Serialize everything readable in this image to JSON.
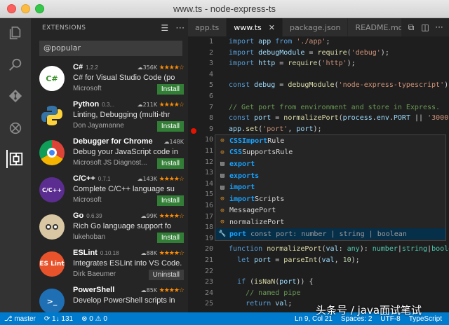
{
  "window": {
    "title": "www.ts - node-express-ts"
  },
  "sidebar": {
    "header": "EXTENSIONS",
    "search_value": "@popular",
    "extensions": [
      {
        "name": "C#",
        "version": "1.2.2",
        "downloads": "356K",
        "description": "C# for Visual Studio Code (po",
        "publisher": "Microsoft",
        "action": "Install",
        "logo_text": "C#",
        "logo_color": "#3a8f29"
      },
      {
        "name": "Python",
        "version": "0.3...",
        "downloads": "211K",
        "description": "Linting, Debugging (multi-thr",
        "publisher": "Don Jayamanne",
        "action": "Install",
        "logo_text": "Py",
        "logo_color": "#3572a5"
      },
      {
        "name": "Debugger for Chrome",
        "version": "",
        "downloads": "148K",
        "description": "Debug your JavaScript code in",
        "publisher": "Microsoft JS Diagnost...",
        "action": "Install",
        "logo_text": "",
        "logo_color": "#db4437"
      },
      {
        "name": "C/C++",
        "version": "0.7.1",
        "downloads": "143K",
        "description": "Complete C/C++ language su",
        "publisher": "Microsoft",
        "action": "Install",
        "logo_text": "C/C++",
        "logo_color": "#5c2d91"
      },
      {
        "name": "Go",
        "version": "0.6.39",
        "downloads": "99K",
        "description": "Rich Go language support fo",
        "publisher": "lukehoban",
        "action": "Install",
        "logo_text": "Go",
        "logo_color": "#d9c7a3"
      },
      {
        "name": "ESLint",
        "version": "0.10.18",
        "downloads": "88K",
        "description": "Integrates ESLint into VS Code.",
        "publisher": "Dirk Baeumer",
        "action": "Uninstall",
        "logo_text": "ES Lint",
        "logo_color": "#e8532b"
      },
      {
        "name": "PowerShell",
        "version": "",
        "downloads": "85K",
        "description": "Develop PowerShell scripts in",
        "publisher": "",
        "action": "",
        "logo_text": ">_",
        "logo_color": "#1f6fb5"
      }
    ]
  },
  "tabs": [
    {
      "label": "app.ts",
      "active": false
    },
    {
      "label": "www.ts",
      "active": true
    },
    {
      "label": "package.json",
      "active": false
    },
    {
      "label": "README.md",
      "active": false
    }
  ],
  "editor": {
    "cursor_line": 9,
    "breakpoint_line": 9
  },
  "suggestions": [
    {
      "kind": "class",
      "match": "CSSImport",
      "rest": "Rule",
      "prefix": "",
      "detail": ""
    },
    {
      "kind": "class",
      "match": "CSS",
      "rest": "Rule",
      "prefix": "",
      "mid": "Supports",
      "detail": ""
    },
    {
      "kind": "module",
      "match": "export",
      "rest": "",
      "prefix": "",
      "detail": ""
    },
    {
      "kind": "module",
      "match": "exports",
      "rest": "",
      "prefix": "",
      "detail": ""
    },
    {
      "kind": "module",
      "match": "import",
      "rest": "",
      "prefix": "",
      "detail": ""
    },
    {
      "kind": "class",
      "match": "import",
      "rest": "Scripts",
      "prefix": "",
      "detail": ""
    },
    {
      "kind": "class",
      "match": "MessagePort",
      "rest": "",
      "prefix": "",
      "detail": ""
    },
    {
      "kind": "class",
      "match": "normalizePort",
      "rest": "",
      "prefix": "",
      "detail": ""
    },
    {
      "kind": "wrench",
      "match": "port",
      "rest": "",
      "prefix": "",
      "detail": "const port: number | string | boolean"
    }
  ],
  "status": {
    "branch": "master",
    "sync": "1↓ 131",
    "errors": "0",
    "warnings": "0",
    "position": "Ln 9, Col 21",
    "indent": "Spaces: 2",
    "encoding": "UTF-8",
    "language": "TypeScript"
  },
  "watermark": "头条号 / java面试笔试",
  "colors": {
    "accent": "#007acc",
    "install": "#327e36",
    "star": "#ff8c00"
  }
}
